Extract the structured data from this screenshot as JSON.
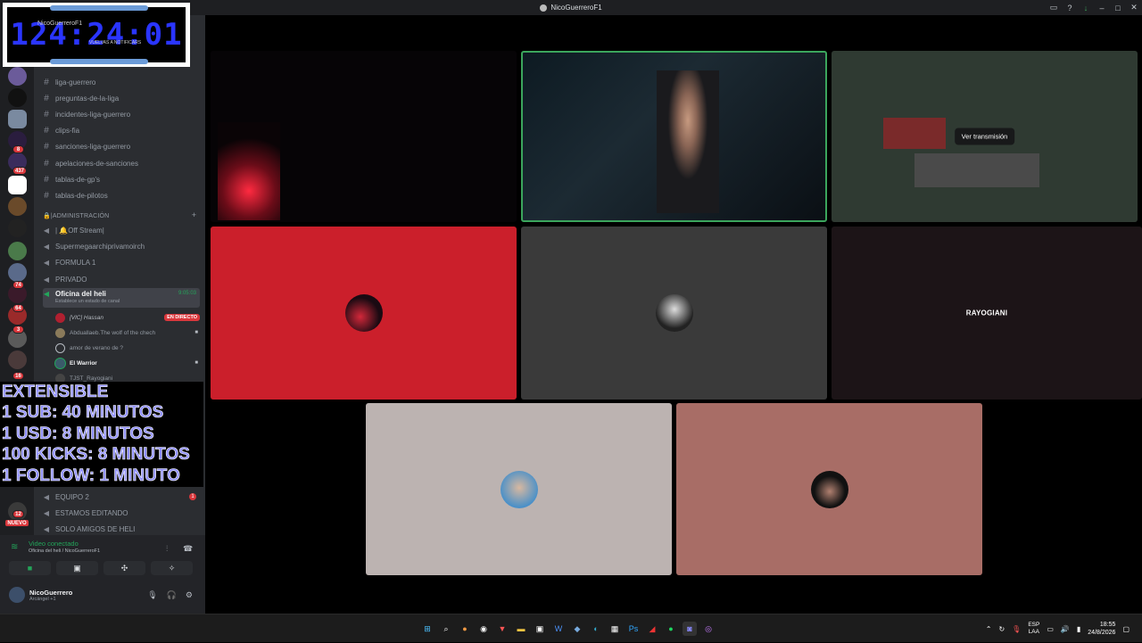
{
  "window": {
    "title": "NicoGuerreroF1"
  },
  "clock_overlay": {
    "time": "124:24:01",
    "underlay_server": "NicoGuerreroF1",
    "underlay_banner": "VUELVAS A NOTIFICARS"
  },
  "extensible_overlay": {
    "lines": [
      "EXTENSIBLE",
      "1 SUB: 40 MINUTOS",
      "1 USD: 8 MINUTOS",
      "100 KICKS: 8 MINUTOS",
      "1 FOLLOW: 1 MINUTO"
    ]
  },
  "server_badges": [
    "1",
    "8",
    "437",
    "74",
    "64",
    "3",
    "16",
    "12",
    "NUEVO"
  ],
  "channels": {
    "text": [
      "liga-guerrero",
      "preguntas-de-la-liga",
      "incidentes-liga-guerrero",
      "clips-fia",
      "sanciones-liga-guerrero",
      "apelaciones-de-sanciones",
      "tablas-de-gp's",
      "tablas-de-pilotos"
    ],
    "category": "🔒|ADMINISTRACIÓN",
    "voice": [
      "| 🔔Off Stream|",
      "Supermegaarchiprivamoirch",
      "FORMULA 1",
      "PRIVADO"
    ],
    "active_voice": {
      "name": "Oficina del heli",
      "status": "Establece un estado de canal",
      "timer": "9:05:03"
    },
    "voice_users": [
      {
        "name": "[VlC] Hassan",
        "live": "EN DIRECTO"
      },
      {
        "name": "Abduallaeb.The wolf of the chech"
      },
      {
        "name": "amor de verano de ?"
      },
      {
        "name": "El Warrior"
      },
      {
        "name": "TJST_Rayogiani"
      }
    ],
    "bottom_voice": [
      "EQUIPO 2",
      "ESTAMOS EDITANDO",
      "SOLO AMIGOS DE HELI"
    ],
    "unread_equipo2": "1"
  },
  "voice_panel": {
    "status": "Video conectado",
    "location": "Oficina del heli / NicoGuerreroF1"
  },
  "user": {
    "name": "NicoGuerrero",
    "status": "Arcángel +1"
  },
  "grid": {
    "stream_button": "Ver transmisión",
    "rayo_label": "RAYOGIANI"
  },
  "tray": {
    "lang1": "ESP",
    "lang2": "LAA",
    "time": "18:55",
    "date": "24/8/2026"
  },
  "colors": {
    "red_tile": "#cb1f2b",
    "gray_tile": "#3a3a3a",
    "dark_tile": "#1c1417",
    "light_tile": "#bcb3b1",
    "rose_tile": "#a86d66",
    "speaking": "#3ba55c"
  }
}
